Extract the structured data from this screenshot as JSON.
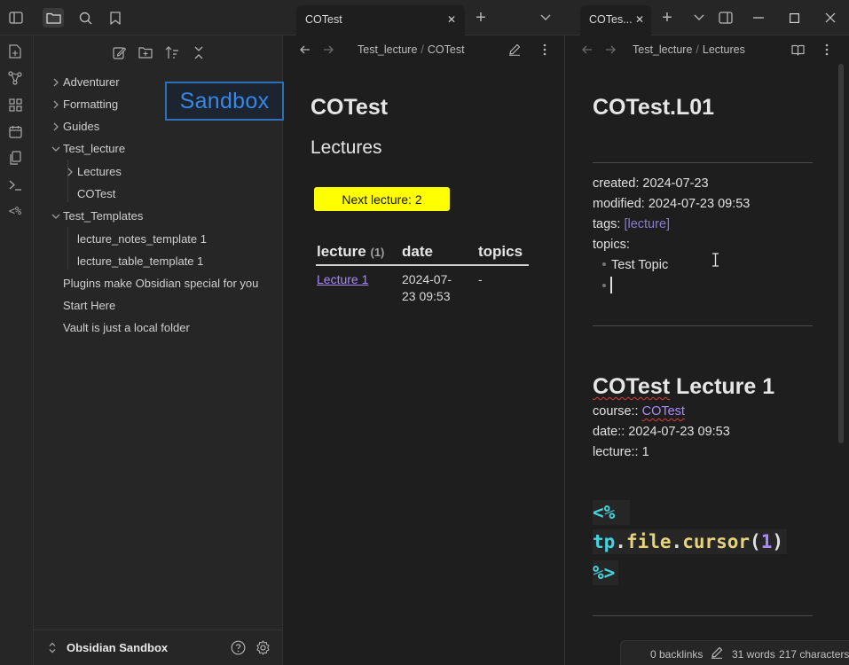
{
  "topbar": {
    "tabs": [
      {
        "title": "COTest",
        "close": "✕"
      },
      {
        "title": "COTes...",
        "close": "✕"
      }
    ],
    "new_tab": "+",
    "tab_list": "⌄"
  },
  "rail": {
    "icons": [
      "file-plus-icon",
      "graph-icon",
      "grid-icon",
      "calendar-icon",
      "copy-icon",
      "terminal-icon",
      "templater-icon"
    ],
    "templater_label": "<%"
  },
  "explorer": {
    "tree": [
      {
        "label": "Adventurer",
        "type": "folder"
      },
      {
        "label": "Formatting",
        "type": "folder"
      },
      {
        "label": "Guides",
        "type": "folder"
      },
      {
        "label": "Test_lecture",
        "type": "folder-open"
      },
      {
        "label": "Lectures",
        "type": "folder"
      },
      {
        "label": "COTest",
        "type": "file"
      },
      {
        "label": "Test_Templates",
        "type": "folder-open"
      },
      {
        "label": "lecture_notes_template 1",
        "type": "file"
      },
      {
        "label": "lecture_table_template 1",
        "type": "file"
      },
      {
        "label": "Plugins make Obsidian special for you",
        "type": "file"
      },
      {
        "label": "Start Here",
        "type": "file"
      },
      {
        "label": "Vault is just a local folder",
        "type": "file"
      }
    ],
    "vault_name": "Obsidian Sandbox"
  },
  "overlay": {
    "sandbox_label": "Sandbox"
  },
  "middle": {
    "breadcrumb": [
      "Test_lecture",
      "COTest"
    ],
    "title": "COTest",
    "subtitle": "Lectures",
    "next_button": "Next lecture: 2",
    "table": {
      "headers": [
        "lecture",
        "date",
        "topics"
      ],
      "count": "(1)",
      "rows": [
        {
          "lecture": "Lecture 1",
          "date_line1": "2024-07-",
          "date_line2": "23 09:53",
          "topics": "-"
        }
      ]
    }
  },
  "right": {
    "breadcrumb": [
      "Test_lecture",
      "Lectures"
    ],
    "title": "COTest.L01",
    "props": {
      "created": "created: 2024-07-23",
      "modified": "modified: 2024-07-23 09:53",
      "tags_label": "tags: ",
      "tags_value": "[lecture]",
      "topics_label": "topics:",
      "topic1": "Test Topic"
    },
    "heading_word1": "COTest",
    "heading_rest": " Lecture 1",
    "course_label": "course:: ",
    "course_link": "COTest",
    "date_line": "date:: 2024-07-23 09:53",
    "lecture_line": "lecture:: 1",
    "code": {
      "open": "<%",
      "tp": "tp",
      "dot1": ".",
      "file": "file",
      "dot2": ".",
      "cursor": "cursor",
      "paren_open": "(",
      "arg": "1",
      "paren_close": ")",
      "close": "%>"
    }
  },
  "status": {
    "backlinks": "0 backlinks",
    "words": "31 words",
    "chars": "217 characters"
  },
  "colors": {
    "accent": "#a88bfa",
    "button_yellow": "#ffff00",
    "overlay_blue": "#3a86e3"
  }
}
